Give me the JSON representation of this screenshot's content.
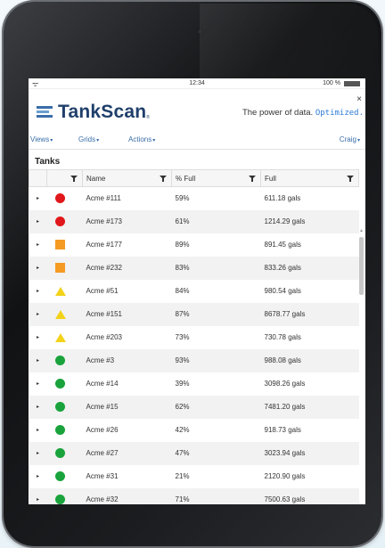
{
  "status_bar": {
    "time": "12:34",
    "battery": "100 %"
  },
  "header": {
    "brand": "TankScan",
    "tm": "®",
    "tagline_prefix": "The power of data. ",
    "tagline_accent": "Optimized.",
    "close": "×"
  },
  "menu": {
    "views": "Views",
    "grids": "Grids",
    "actions": "Actions",
    "user": "Craig",
    "caret": "▾"
  },
  "section_title": "Tanks",
  "columns": {
    "name": "Name",
    "pct": "% Full",
    "full": "Full"
  },
  "colors": {
    "red": "#e0181b",
    "orange": "#f59a23",
    "yellow": "#f3d21a",
    "green": "#1aa33c"
  },
  "rows": [
    {
      "status": "red-circle",
      "name": "Acme #111",
      "pct": "59%",
      "full": "611.18 gals"
    },
    {
      "status": "red-circle",
      "name": "Acme #173",
      "pct": "61%",
      "full": "1214.29 gals"
    },
    {
      "status": "orange-square",
      "name": "Acme #177",
      "pct": "89%",
      "full": "891.45 gals"
    },
    {
      "status": "orange-square",
      "name": "Acme #232",
      "pct": "83%",
      "full": "833.26 gals"
    },
    {
      "status": "yellow-triangle",
      "name": "Acme #51",
      "pct": "84%",
      "full": "980.54 gals"
    },
    {
      "status": "yellow-triangle",
      "name": "Acme #151",
      "pct": "87%",
      "full": "8678.77 gals"
    },
    {
      "status": "yellow-triangle",
      "name": "Acme #203",
      "pct": "73%",
      "full": "730.78 gals"
    },
    {
      "status": "green-circle",
      "name": "Acme #3",
      "pct": "93%",
      "full": "988.08 gals"
    },
    {
      "status": "green-circle",
      "name": "Acme #14",
      "pct": "39%",
      "full": "3098.26 gals"
    },
    {
      "status": "green-circle",
      "name": "Acme #15",
      "pct": "62%",
      "full": "7481.20 gals"
    },
    {
      "status": "green-circle",
      "name": "Acme #26",
      "pct": "42%",
      "full": "918.73 gals"
    },
    {
      "status": "green-circle",
      "name": "Acme #27",
      "pct": "47%",
      "full": "3023.94 gals"
    },
    {
      "status": "green-circle",
      "name": "Acme #31",
      "pct": "21%",
      "full": "2120.90 gals"
    },
    {
      "status": "green-circle",
      "name": "Acme #32",
      "pct": "71%",
      "full": "7500.63 gals"
    }
  ]
}
